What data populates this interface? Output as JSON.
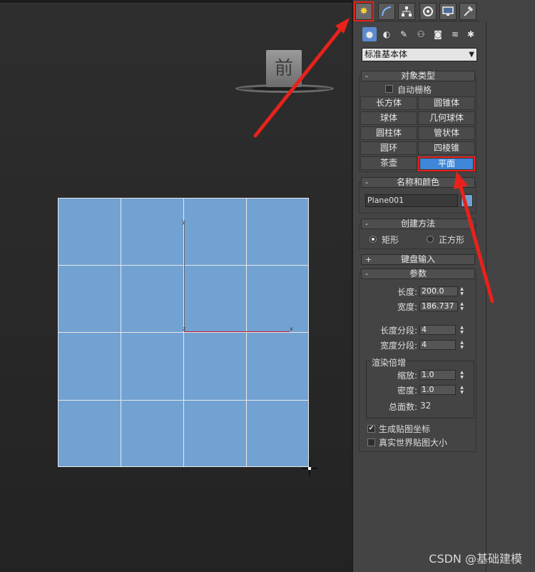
{
  "viewport": {
    "viewcube_label": "前",
    "axis_y": "y",
    "axis_x": "x",
    "axis_z": "z",
    "plane_color": "#72a2d2"
  },
  "command_panel": {
    "tabs": [
      {
        "name": "create-tab",
        "icon": "create-star-icon",
        "active": true
      },
      {
        "name": "modify-tab",
        "icon": "modify-arc-icon"
      },
      {
        "name": "hierarchy-tab",
        "icon": "hierarchy-icon"
      },
      {
        "name": "motion-tab",
        "icon": "motion-icon"
      },
      {
        "name": "display-tab",
        "icon": "display-monitor-icon"
      },
      {
        "name": "utilities-tab",
        "icon": "hammer-icon"
      }
    ],
    "categories": [
      "geometry-icon",
      "shapes-icon",
      "lights-icon",
      "cameras-icon",
      "helpers-icon",
      "space-warps-icon",
      "systems-icon"
    ],
    "primitive_type": "标准基本体",
    "object_type": {
      "title": "对象类型",
      "autogrid_label": "自动栅格",
      "buttons": [
        "长方体",
        "圆锥体",
        "球体",
        "几何球体",
        "圆柱体",
        "管状体",
        "圆环",
        "四棱锥",
        "茶壶",
        "平面"
      ],
      "active": "平面"
    },
    "name_color": {
      "title": "名称和颜色",
      "name_value": "Plane001",
      "color": "#72a2d2"
    },
    "creation_method": {
      "title": "创建方法",
      "options": [
        "矩形",
        "正方形"
      ],
      "selected": "矩形"
    },
    "keyboard_entry": {
      "title": "键盘输入"
    },
    "parameters": {
      "title": "参数",
      "length_label": "长度:",
      "length_value": "200.0",
      "width_label": "宽度:",
      "width_value": "186.737",
      "length_segs_label": "长度分段:",
      "length_segs_value": "4",
      "width_segs_label": "宽度分段:",
      "width_segs_value": "4",
      "render_group_title": "渲染倍增",
      "scale_label": "缩放:",
      "scale_value": "1.0",
      "density_label": "密度:",
      "density_value": "1.0",
      "total_faces_label": "总面数:",
      "total_faces_value": "32",
      "gen_mapping_label": "生成贴图坐标",
      "gen_mapping_checked": true,
      "real_world_label": "真实世界贴图大小",
      "real_world_checked": false
    }
  },
  "signs": {
    "minus": "-",
    "plus": "+",
    "check": "✔"
  },
  "watermark": "CSDN @基础建模",
  "annotation_color": "#e8221b"
}
